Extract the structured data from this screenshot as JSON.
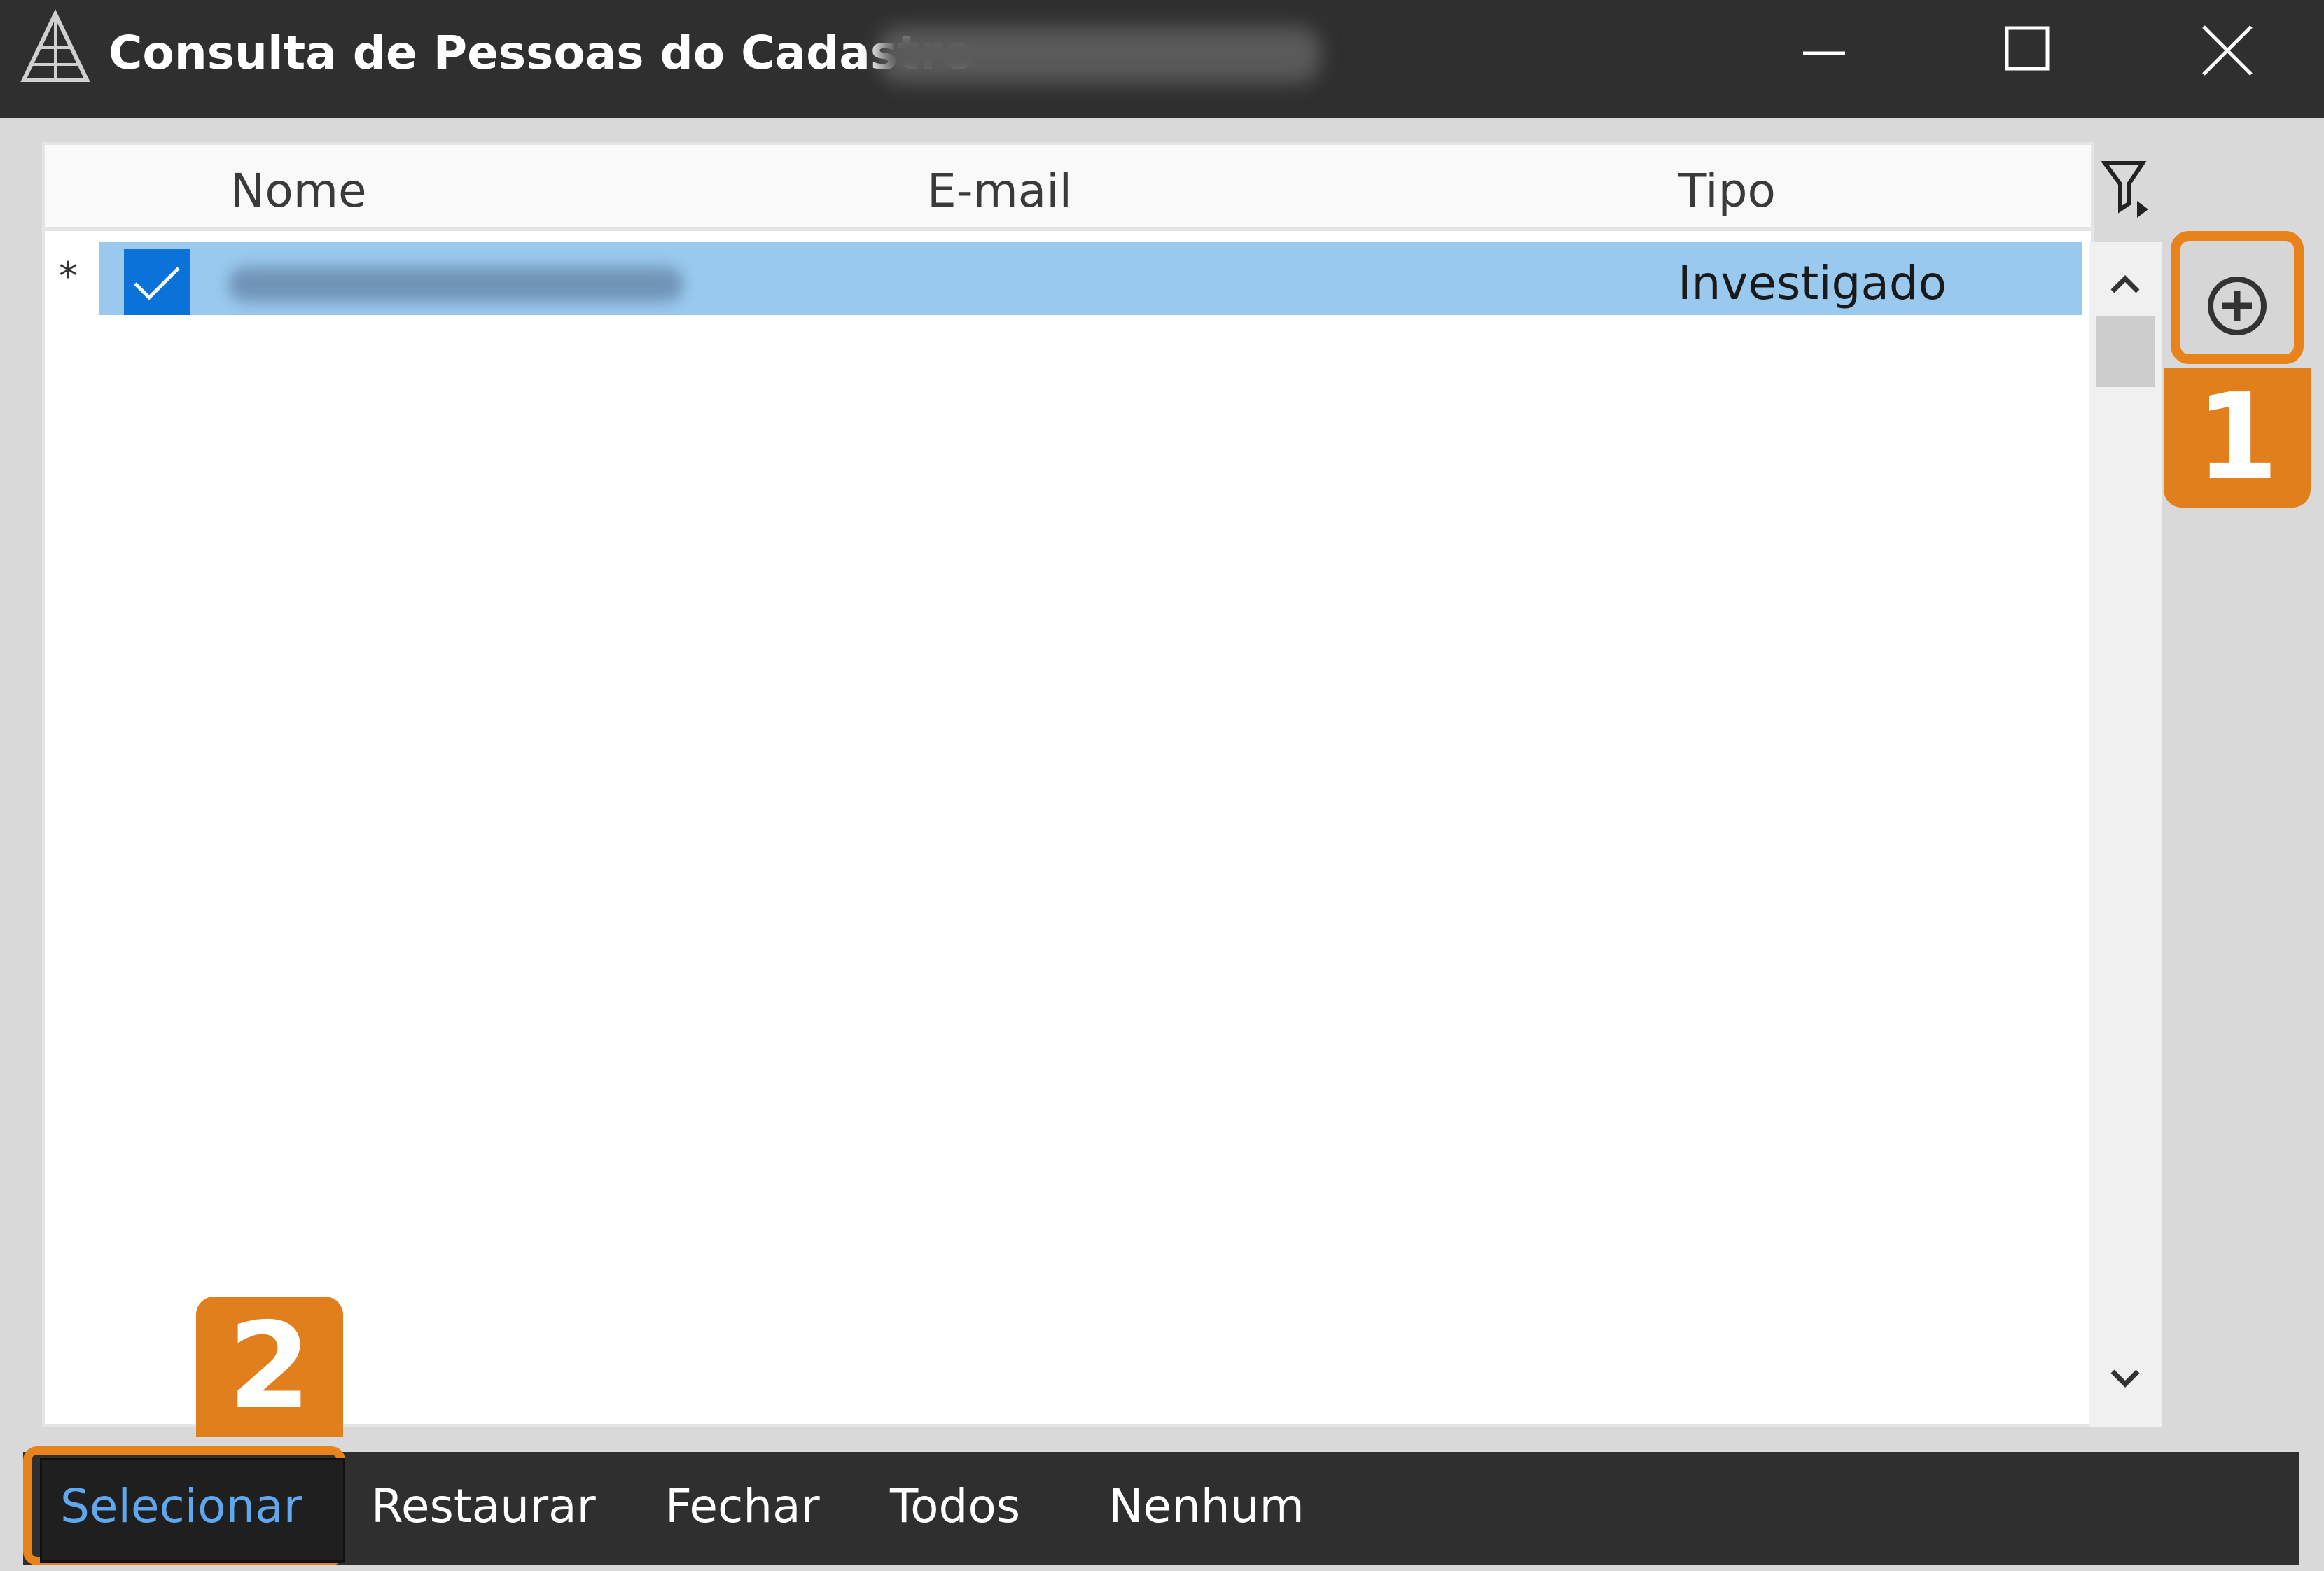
{
  "window": {
    "title": "Consulta de Pessoas do Cadastro",
    "controls": {
      "minimize": "minimize-icon",
      "maximize": "maximize-icon",
      "close": "close-icon"
    }
  },
  "grid": {
    "columns": [
      "Nome",
      "E-mail",
      "Tipo"
    ],
    "rows": [
      {
        "marker": "*",
        "checked": true,
        "tipo": "Investigado"
      }
    ]
  },
  "side_actions": {
    "add_icon": "plus-circle-icon",
    "filter_icon": "filter-icon"
  },
  "annotations": {
    "badge_1": "1",
    "badge_2": "2",
    "highlight_color": "#e8831c"
  },
  "toolbar": {
    "selecionar": "Selecionar",
    "restaurar": "Restaurar",
    "fechar": "Fechar",
    "todos": "Todos",
    "nenhum": "Nenhum"
  },
  "colors": {
    "titlebar": "#2f2f2f",
    "selected_row": "#99c9ee",
    "checkbox": "#0a72d9",
    "selected_button_text": "#5fa8ee"
  }
}
